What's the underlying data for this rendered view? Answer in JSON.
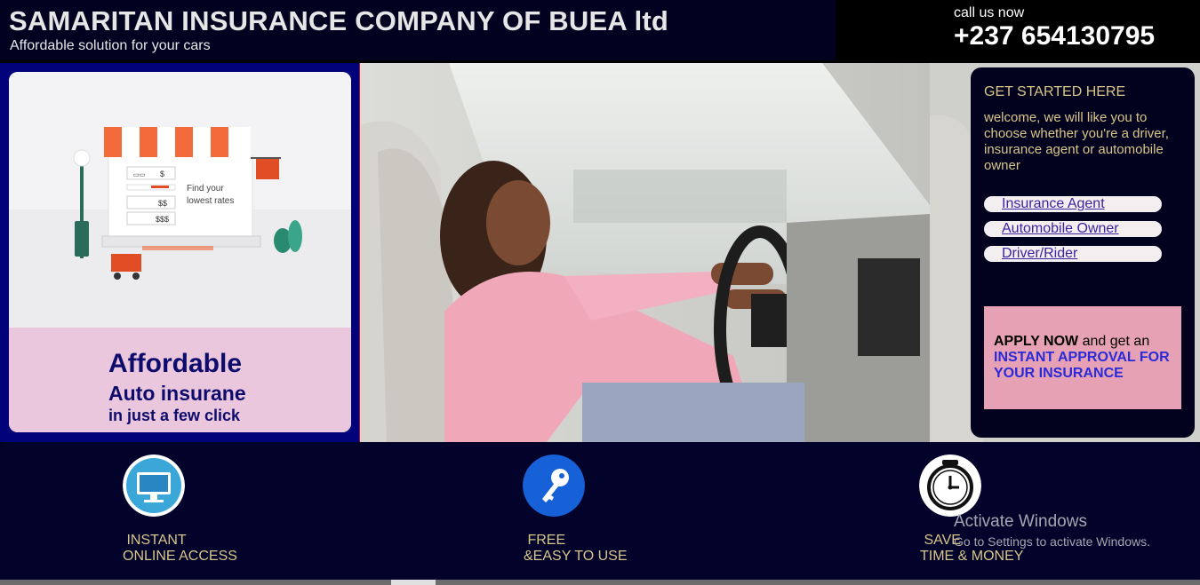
{
  "header": {
    "company_name": "SAMARITAN INSURANCE COMPANY OF BUEA ltd",
    "tagline": "Affordable solution for your cars",
    "call_label": "call us now",
    "phone": "+237 654130795"
  },
  "promo": {
    "illustration_text": "Find your lowest rates",
    "price_tags": [
      "$",
      "$$",
      "$$$"
    ],
    "title": "Affordable",
    "subtitle": "Auto insurane",
    "subtitle2": "in just a few click"
  },
  "start_panel": {
    "title": "GET STARTED HERE",
    "text": "welcome, we will like you to choose whether you're a driver, insurance agent or automobile owner",
    "links": [
      "Insurance Agent",
      "Automobile Owner",
      "Driver/Rider"
    ],
    "apply_strong": "APPLY NOW",
    "apply_plain": " and get an ",
    "apply_blue": "INSTANT APPROVAL FOR YOUR INSURANCE"
  },
  "features": [
    {
      "label": " INSTANT\nONLINE ACCESS",
      "icon": "computer-icon"
    },
    {
      "label": " FREE\n&EASY TO USE",
      "icon": "key-icon"
    },
    {
      "label": " SAVE\nTIME & MONEY",
      "icon": "clock-icon"
    }
  ],
  "watermark": {
    "title": "Activate Windows",
    "subtitle": "Go to Settings to activate Windows."
  },
  "colors": {
    "accent_gold": "#d8c68a",
    "navy": "#02022a",
    "pink_box": "#e6a2b4",
    "promo_pink": "#ebc7de"
  }
}
